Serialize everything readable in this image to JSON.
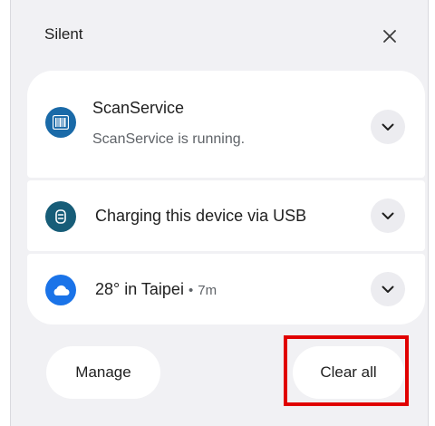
{
  "section": {
    "title": "Silent",
    "close_icon": "close-icon"
  },
  "notifications": [
    {
      "app_icon": "barcode-scanner-icon",
      "icon_color": "#1a6aa8",
      "title": "ScanService",
      "text": "ScanService is running."
    },
    {
      "app_icon": "usb-charging-icon",
      "icon_color": "#175d78",
      "title": "Charging this device via USB"
    },
    {
      "app_icon": "cloud-icon",
      "icon_color": "#1a73e8",
      "title": "28° in Taipei",
      "separator": "•",
      "time": "7m"
    }
  ],
  "actions": {
    "manage_label": "Manage",
    "clear_all_label": "Clear all"
  },
  "highlight_color": "#e00000"
}
